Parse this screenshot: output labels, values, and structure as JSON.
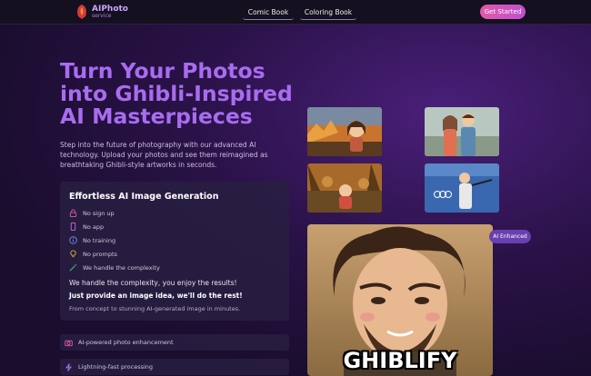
{
  "header": {
    "logo_title": "AIPhoto",
    "logo_sub": "service",
    "nav": [
      "Comic Book",
      "Coloring Book"
    ],
    "cta": "Get Started"
  },
  "hero": {
    "title_lines": [
      "Turn Your Photos",
      "into Ghibli-Inspired",
      "AI Masterpieces"
    ],
    "description": "Step into the future of photography with our advanced AI technology. Upload your photos and see them reimagined as breathtaking Ghibli-style artworks in seconds."
  },
  "card": {
    "title": "Effortless AI Image Generation",
    "features": [
      {
        "icon": "lock-icon",
        "label": "No sign up"
      },
      {
        "icon": "phone-icon",
        "label": "No app"
      },
      {
        "icon": "info-icon",
        "label": "No training"
      },
      {
        "icon": "lightbulb-icon",
        "label": "No prompts"
      },
      {
        "icon": "magic-wand-icon",
        "label": "We handle the complexity"
      }
    ],
    "line1": "We handle the complexity, you enjoy the results!",
    "line2": "Just provide an image idea, we'll do the rest!",
    "line3": "From concept to stunning AI-generated image in minutes."
  },
  "pills": [
    {
      "icon": "camera-icon",
      "label": "AI-powered photo enhancement"
    },
    {
      "icon": "lightning-icon",
      "label": "Lightning-fast processing"
    }
  ],
  "gallery": {
    "badge": "AI Enhanced",
    "big_caption": "GHIBLIFY"
  },
  "colors": {
    "accent": "#a86cf0",
    "cta_start": "#e05aa6",
    "cta_end": "#c050d0",
    "badge": "#6a3fb0"
  }
}
